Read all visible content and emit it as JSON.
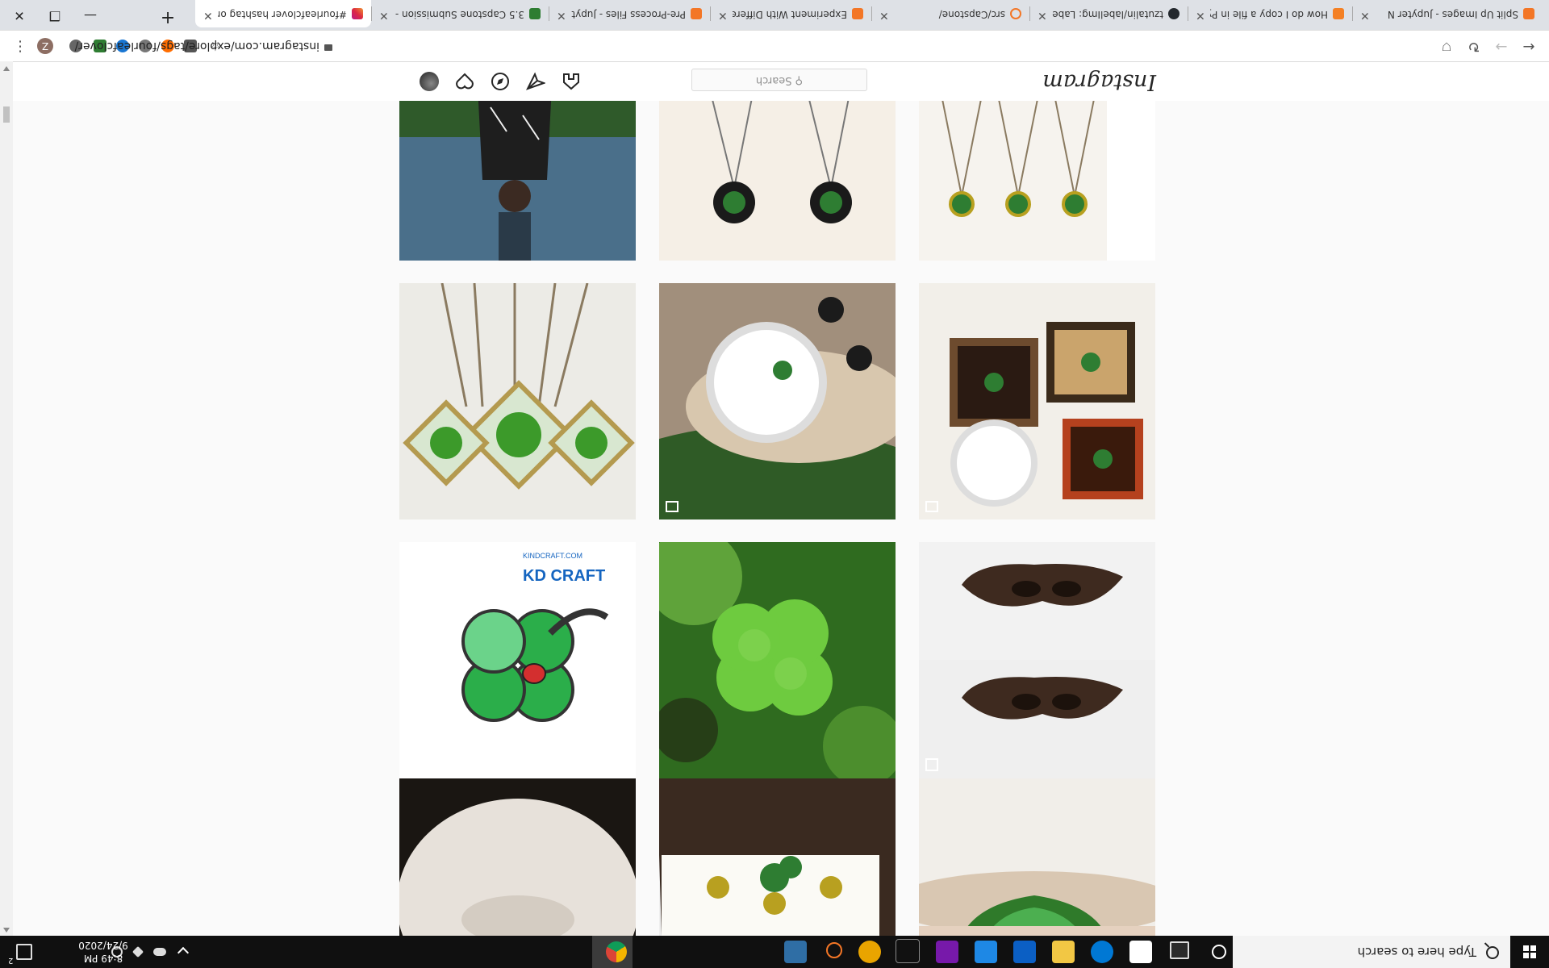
{
  "taskbar": {
    "search_placeholder": "Type here to search",
    "clock_time": "8:49 PM",
    "clock_date": "9/24/2020",
    "notification_count": "2"
  },
  "browser": {
    "url": "instagram.com/explore/tags/fourleafclover/",
    "tabs": [
      {
        "title": "Split Up Images - Jupyter N",
        "fav_color": "#f37626"
      },
      {
        "title": "How do I copy a file in Pyth",
        "fav_color": "#f48024"
      },
      {
        "title": "tzutalin/labelImg: Label",
        "fav_color": "#24292e"
      },
      {
        "title": "src/Capstone/",
        "fav_color": "#f37626"
      },
      {
        "title": "Experiment With Different",
        "fav_color": "#f37626"
      },
      {
        "title": "Pre-Process Files - Jupyter",
        "fav_color": "#f37626"
      },
      {
        "title": "3.5 Capstone Submission -",
        "fav_color": "#2e7d32"
      },
      {
        "title": "#fourleafclover hashtag on",
        "fav_color": "#c13584"
      }
    ],
    "profile_initial": "Z"
  },
  "instagram": {
    "logo_text": "Instagram",
    "search_placeholder": "Search"
  },
  "posts": [
    {
      "kind": "partial-clover-hand"
    },
    {
      "kind": "clover-card"
    },
    {
      "kind": "white-bowl"
    },
    {
      "kind": "wooden-clover-dish",
      "badge": "carousel"
    },
    {
      "kind": "green-clover-closeup"
    },
    {
      "kind": "kd-craft-ladybug-clover",
      "caption": "KD CRAFT",
      "subcaption": "KINDCRAFT.COM"
    },
    {
      "kind": "framed-clovers-collection",
      "badge": "carousel"
    },
    {
      "kind": "round-frame-necklaces",
      "badge": "carousel"
    },
    {
      "kind": "square-clover-pendants"
    },
    {
      "kind": "clover-pendants-wood-board"
    },
    {
      "kind": "clover-earrings-wood"
    },
    {
      "kind": "person-with-shirt"
    }
  ]
}
